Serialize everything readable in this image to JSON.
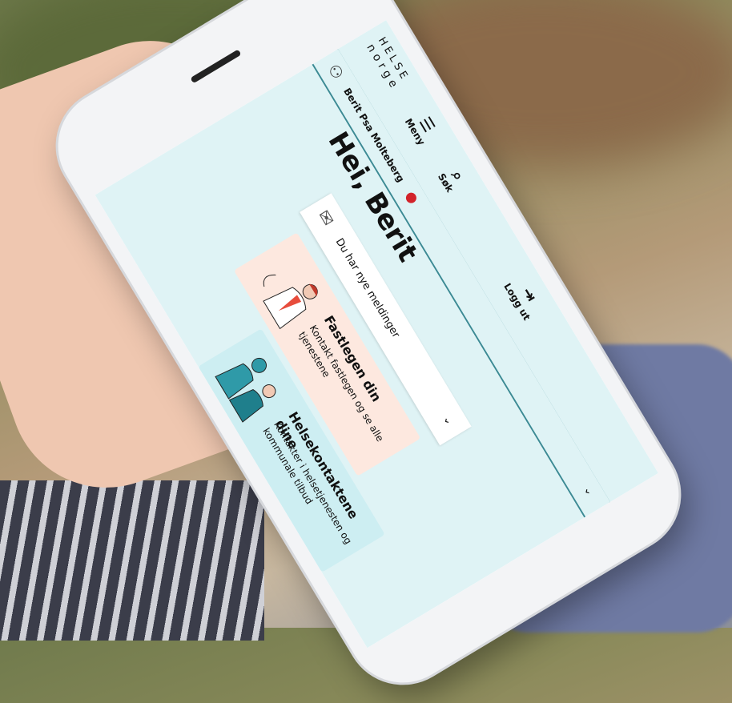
{
  "app": {
    "logo_line1": "HELSE",
    "logo_line2": "norge"
  },
  "nav": {
    "menu_label": "Meny",
    "search_label": "Søk",
    "logout_label": "Logg ut"
  },
  "user": {
    "name": "Berit Psa Molteberg"
  },
  "main": {
    "greeting": "Hei, Berit",
    "message_card": {
      "label": "Du har nye meldinger"
    },
    "cards": [
      {
        "title": "Fastlegen din",
        "subtitle": "Kontakt fastlegen og se alle tjenestene"
      },
      {
        "title": "Helsekontaktene dine",
        "subtitle": "Kontakter i helsetjenesten og kommunale tilbud"
      }
    ]
  },
  "colors": {
    "header_bg": "#dff3f5",
    "accent_line": "#3c8a94",
    "notification_dot": "#d2232a",
    "card_gp_bg": "#fde8df",
    "card_hk_bg": "#cdeef2"
  },
  "icons": {
    "menu": "menu-icon",
    "search": "search-icon",
    "logout": "logout-icon",
    "user": "user-icon",
    "message": "envelope-icon",
    "chevron": "chevron-down-icon"
  }
}
